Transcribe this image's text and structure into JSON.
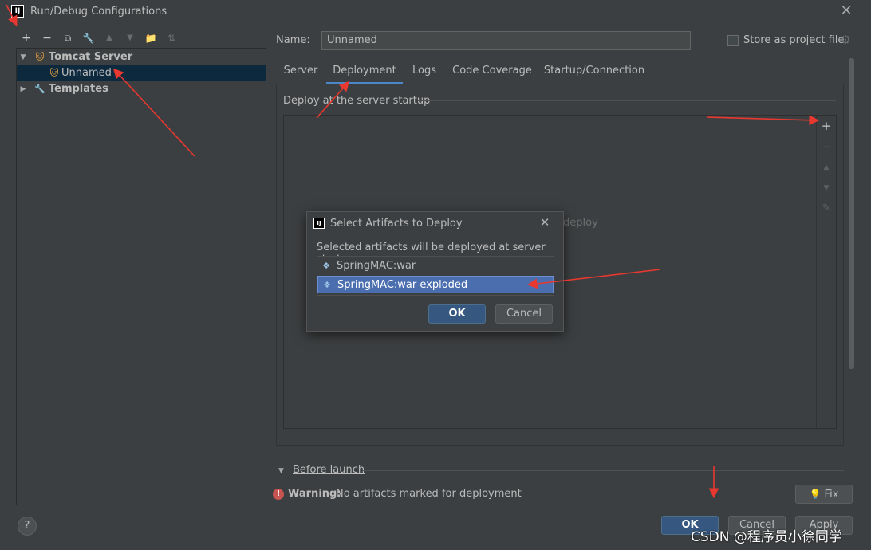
{
  "window": {
    "title": "Run/Debug Configurations",
    "app_icon": "IJ"
  },
  "toolbar": {
    "items": [
      {
        "icon": "add-icon",
        "glyph": "+",
        "enabled": true
      },
      {
        "icon": "remove-icon",
        "glyph": "−",
        "enabled": true
      },
      {
        "icon": "copy-icon",
        "glyph": "⧉",
        "enabled": true
      },
      {
        "icon": "wrench-icon",
        "glyph": "🔧",
        "enabled": true
      },
      {
        "icon": "move-up-icon",
        "glyph": "▲",
        "enabled": false
      },
      {
        "icon": "move-down-icon",
        "glyph": "▼",
        "enabled": false
      },
      {
        "icon": "folder-icon",
        "glyph": "📁",
        "enabled": true
      },
      {
        "icon": "sort-icon",
        "glyph": "⇅",
        "enabled": false
      }
    ]
  },
  "tree": {
    "group": "Tomcat Server",
    "child": "Unnamed",
    "templates": "Templates"
  },
  "name_field": {
    "label": "Name:",
    "value": "Unnamed"
  },
  "store_project": {
    "label": "Store as project file",
    "checked": false
  },
  "tabs": [
    "Server",
    "Deployment",
    "Logs",
    "Code Coverage",
    "Startup/Connection"
  ],
  "active_tab": "Deployment",
  "deployment": {
    "section_title": "Deploy at the server startup",
    "empty_text": "deploy"
  },
  "before_launch": "Before launch",
  "warning": {
    "bold": "Warning:",
    "text": "No artifacts marked for deployment"
  },
  "buttons": {
    "fix": "Fix",
    "ok": "OK",
    "cancel": "Cancel",
    "apply": "Apply",
    "help": "?"
  },
  "modal": {
    "title": "Select Artifacts to Deploy",
    "description": "Selected artifacts will be deployed at server startup",
    "artifacts": [
      "SpringMAC:war",
      "SpringMAC:war exploded"
    ],
    "selected_index": 1,
    "ok": "OK",
    "cancel": "Cancel"
  },
  "colors": {
    "accent": "#4a88c7",
    "selection": "#4b6eaf",
    "primary_button": "#365880",
    "annotation_arrow": "#e8382f"
  },
  "watermark": "CSDN @程序员小徐同学"
}
